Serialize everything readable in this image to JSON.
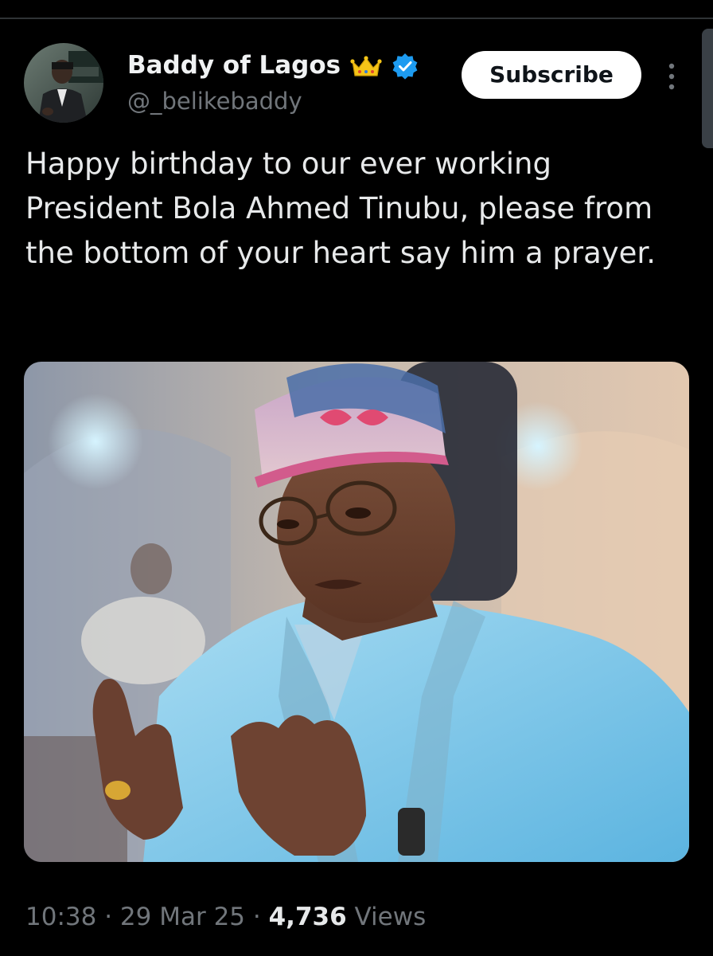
{
  "author": {
    "display_name": "Baddy of Lagos",
    "handle": "@_belikebaddy",
    "badges": [
      "crown-icon",
      "verified-icon"
    ]
  },
  "actions": {
    "subscribe_label": "Subscribe",
    "more_icon": "more-vertical-icon"
  },
  "tweet": {
    "text": "Happy birthday to our ever working President Bola Ahmed Tinubu, please from the bottom of your heart say him a prayer.",
    "photo": "tweet-photo"
  },
  "meta": {
    "time": "10:38",
    "separator": "·",
    "date": "29 Mar 25",
    "views_count": "4,736",
    "views_label": "Views"
  },
  "colors": {
    "background": "#000000",
    "text_primary": "#e7e9ea",
    "text_secondary": "#71767b",
    "verified_blue": "#1d9bf0",
    "crown_gold": "#f5c518",
    "button_bg": "#ffffff",
    "button_text": "#0f1419"
  }
}
